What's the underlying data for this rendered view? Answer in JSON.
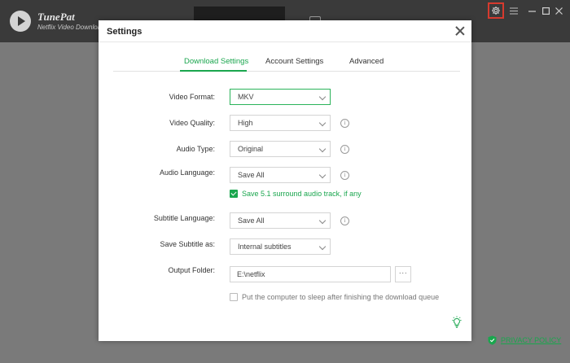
{
  "app": {
    "name": "TunePat",
    "subtitle": "Netflix Video Downloader"
  },
  "dialog": {
    "title": "Settings",
    "tabs": [
      {
        "label": "Download Settings",
        "active": true
      },
      {
        "label": "Account Settings",
        "active": false
      },
      {
        "label": "Advanced",
        "active": false
      }
    ],
    "video_format": {
      "label": "Video Format:",
      "value": "MKV"
    },
    "video_quality": {
      "label": "Video Quality:",
      "value": "High"
    },
    "audio_type": {
      "label": "Audio Type:",
      "value": "Original"
    },
    "audio_language": {
      "label": "Audio Language:",
      "value": "Save All"
    },
    "surround_checkbox": {
      "label": "Save 5.1 surround audio track, if any",
      "checked": true
    },
    "subtitle_language": {
      "label": "Subtitle Language:",
      "value": "Save All"
    },
    "save_subtitle": {
      "label": "Save Subtitle as:",
      "value": "Internal subtitles"
    },
    "output_folder": {
      "label": "Output Folder:",
      "value": "E:\\netflix",
      "browse_label": "···"
    },
    "sleep_checkbox": {
      "label": "Put the computer to sleep after finishing the download queue",
      "checked": false
    }
  },
  "footer": {
    "privacy_label": "PRIVACY POLICY"
  },
  "colors": {
    "accent": "#1aa64e",
    "titlebar": "#3a3a3a",
    "overlay": "#7a7a7a",
    "highlight": "#d63a2e"
  }
}
